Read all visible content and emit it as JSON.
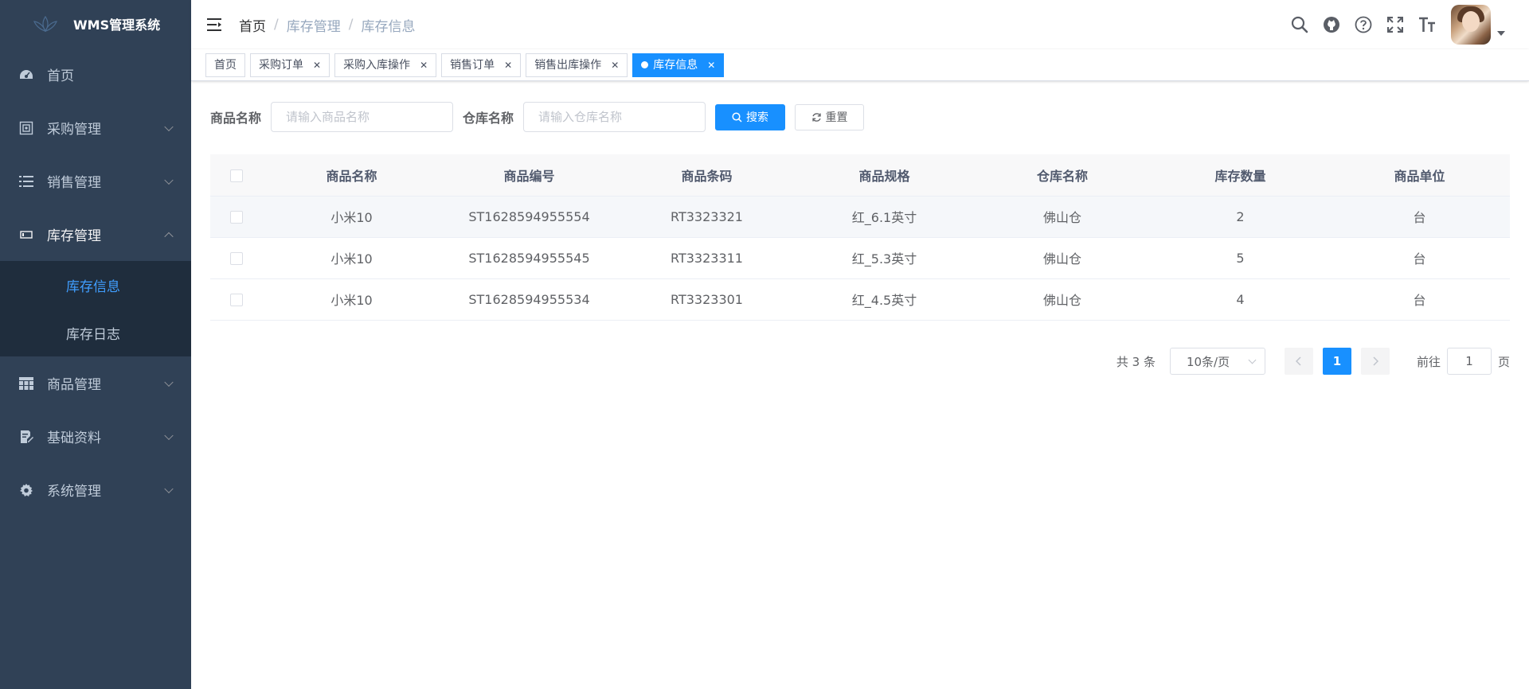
{
  "app": {
    "title": "WMS管理系统"
  },
  "sidebar": {
    "items": [
      {
        "label": "首页",
        "icon": "dashboard-icon"
      },
      {
        "label": "采购管理",
        "icon": "purchase-icon"
      },
      {
        "label": "销售管理",
        "icon": "list-icon"
      },
      {
        "label": "库存管理",
        "icon": "inventory-icon"
      },
      {
        "label": "商品管理",
        "icon": "table-icon"
      },
      {
        "label": "基础资料",
        "icon": "document-edit-icon"
      },
      {
        "label": "系统管理",
        "icon": "gear-icon"
      }
    ],
    "inventory_sub": [
      {
        "label": "库存信息"
      },
      {
        "label": "库存日志"
      }
    ]
  },
  "breadcrumb": [
    "首页",
    "库存管理",
    "库存信息"
  ],
  "tags": [
    {
      "label": "首页"
    },
    {
      "label": "采购订单"
    },
    {
      "label": "采购入库操作"
    },
    {
      "label": "销售订单"
    },
    {
      "label": "销售出库操作"
    },
    {
      "label": "库存信息"
    }
  ],
  "search": {
    "product_label": "商品名称",
    "product_placeholder": "请输入商品名称",
    "warehouse_label": "仓库名称",
    "warehouse_placeholder": "请输入仓库名称",
    "search_button": "搜索",
    "reset_button": "重置"
  },
  "table": {
    "columns": [
      "商品名称",
      "商品编号",
      "商品条码",
      "商品规格",
      "仓库名称",
      "库存数量",
      "商品单位"
    ],
    "rows": [
      [
        "小米10",
        "ST1628594955554",
        "RT3323321",
        "红_6.1英寸",
        "佛山仓",
        "2",
        "台"
      ],
      [
        "小米10",
        "ST1628594955545",
        "RT3323311",
        "红_5.3英寸",
        "佛山仓",
        "5",
        "台"
      ],
      [
        "小米10",
        "ST1628594955534",
        "RT3323301",
        "红_4.5英寸",
        "佛山仓",
        "4",
        "台"
      ]
    ]
  },
  "pagination": {
    "total": "共 3 条",
    "page_size": "10条/页",
    "current_page": "1",
    "goto_label": "前往",
    "goto_value": "1",
    "page_suffix": "页"
  },
  "colors": {
    "sidebar_bg": "#304156",
    "submenu_bg": "#1f2d3d",
    "accent": "#1890ff",
    "active_text": "#409eff"
  }
}
